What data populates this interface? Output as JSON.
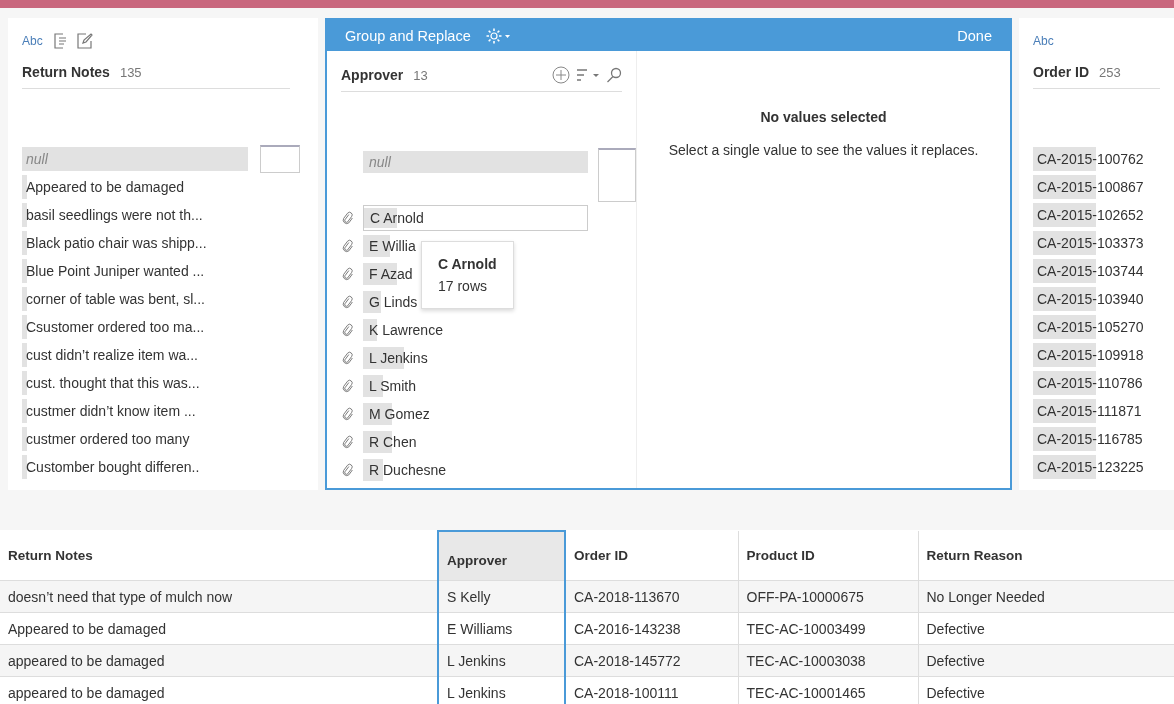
{
  "left_card": {
    "type_label": "Abc",
    "title": "Return Notes",
    "count": "135",
    "values": [
      {
        "text": "null",
        "kind": "null",
        "level": 1
      },
      {
        "text": "Appeared to be damaged",
        "kind": "value",
        "level": 0.02
      },
      {
        "text": "basil seedlings were not th...",
        "kind": "value",
        "level": 0.02
      },
      {
        "text": "Black patio chair was shipp...",
        "kind": "value",
        "level": 0.02
      },
      {
        "text": "Blue Point Juniper wanted ...",
        "kind": "value",
        "level": 0.02
      },
      {
        "text": "corner of table was bent, sl...",
        "kind": "value",
        "level": 0.02
      },
      {
        "text": "Csustomer ordered too ma...",
        "kind": "value",
        "level": 0.02
      },
      {
        "text": "cust didn’t realize item wa...",
        "kind": "value",
        "level": 0.02
      },
      {
        "text": "cust. thought that this was...",
        "kind": "value",
        "level": 0.02
      },
      {
        "text": "custmer didn’t know item ...",
        "kind": "value",
        "level": 0.02
      },
      {
        "text": "custmer ordered too many",
        "kind": "value",
        "level": 0.02
      },
      {
        "text": "Customber bought differen..",
        "kind": "value",
        "level": 0.02
      }
    ]
  },
  "group_replace": {
    "title": "Group and Replace",
    "done": "Done",
    "field": {
      "title": "Approver",
      "count": "13",
      "values": [
        {
          "text": "null",
          "kind": "null",
          "level": 1,
          "hovered": false
        },
        {
          "text": "C Arnold",
          "kind": "group",
          "level": 0.15,
          "hovered": true
        },
        {
          "text": "E Willia",
          "kind": "group",
          "level": 0.12,
          "hovered": false
        },
        {
          "text": "F Azad",
          "kind": "group",
          "level": 0.15,
          "hovered": false
        },
        {
          "text": "G Linds",
          "kind": "group",
          "level": 0.08,
          "hovered": false
        },
        {
          "text": "K Lawrence",
          "kind": "group",
          "level": 0.06,
          "hovered": false
        },
        {
          "text": "L Jenkins",
          "kind": "group",
          "level": 0.18,
          "hovered": false
        },
        {
          "text": "L Smith",
          "kind": "group",
          "level": 0.09,
          "hovered": false
        },
        {
          "text": "M Gomez",
          "kind": "group",
          "level": 0.13,
          "hovered": false
        },
        {
          "text": "R Chen",
          "kind": "group",
          "level": 0.13,
          "hovered": false
        },
        {
          "text": "R Duchesne",
          "kind": "group",
          "level": 0.09,
          "hovered": false
        }
      ]
    },
    "tooltip": {
      "title": "C Arnold",
      "subtitle": "17 rows"
    },
    "detail": {
      "heading": "No values selected",
      "message": "Select a single value to see the values it replaces."
    }
  },
  "right_card": {
    "type_label": "Abc",
    "title": "Order ID",
    "count": "253",
    "values": [
      {
        "text": "CA-2015-100762",
        "kind": "value",
        "level": 0.45
      },
      {
        "text": "CA-2015-100867",
        "kind": "value",
        "level": 0.45
      },
      {
        "text": "CA-2015-102652",
        "kind": "value",
        "level": 0.45
      },
      {
        "text": "CA-2015-103373",
        "kind": "value",
        "level": 0.45
      },
      {
        "text": "CA-2015-103744",
        "kind": "value",
        "level": 0.45
      },
      {
        "text": "CA-2015-103940",
        "kind": "value",
        "level": 0.45
      },
      {
        "text": "CA-2015-105270",
        "kind": "value",
        "level": 0.45
      },
      {
        "text": "CA-2015-109918",
        "kind": "value",
        "level": 0.45
      },
      {
        "text": "CA-2015-110786",
        "kind": "value",
        "level": 0.45
      },
      {
        "text": "CA-2015-111871",
        "kind": "value",
        "level": 0.45
      },
      {
        "text": "CA-2015-116785",
        "kind": "value",
        "level": 0.45
      },
      {
        "text": "CA-2015-123225",
        "kind": "value",
        "level": 0.45
      }
    ]
  },
  "table": {
    "columns": [
      {
        "label": "Return Notes",
        "selected": false
      },
      {
        "label": "Approver",
        "selected": true
      },
      {
        "label": "Order ID",
        "selected": false
      },
      {
        "label": "Product ID",
        "selected": false
      },
      {
        "label": "Return Reason",
        "selected": false
      }
    ],
    "rows": [
      [
        "doesn’t need that type of mulch now",
        "S Kelly",
        "CA-2018-113670",
        "OFF-PA-10000675",
        "No Longer Needed"
      ],
      [
        "Appeared to be damaged",
        "E Williams",
        "CA-2016-143238",
        "TEC-AC-10003499",
        "Defective"
      ],
      [
        "appeared to be damaged",
        "L Jenkins",
        "CA-2018-145772",
        "TEC-AC-10003038",
        "Defective"
      ],
      [
        "appeared to be damaged",
        "L Jenkins",
        "CA-2018-100111",
        "TEC-AC-10001465",
        "Defective"
      ]
    ]
  }
}
